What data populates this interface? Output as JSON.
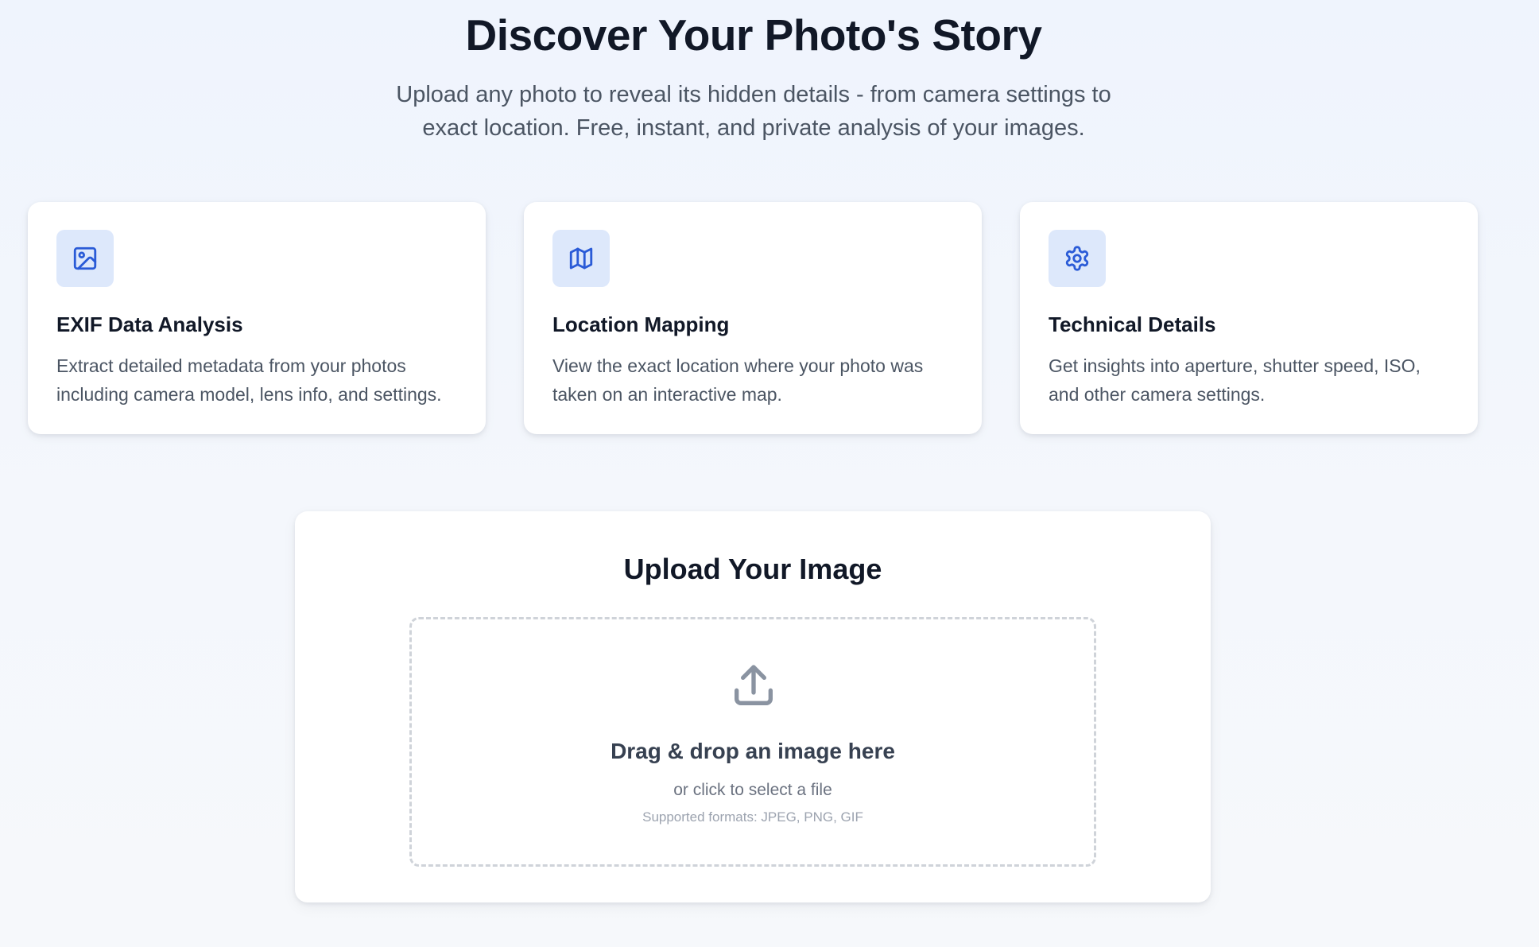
{
  "hero": {
    "title": "Discover Your Photo's Story",
    "subtitle": "Upload any photo to reveal its hidden details - from camera settings to exact location. Free, instant, and private analysis of your images."
  },
  "features": [
    {
      "icon": "image-icon",
      "title": "EXIF Data Analysis",
      "description": "Extract detailed metadata from your photos including camera model, lens info, and settings."
    },
    {
      "icon": "map-icon",
      "title": "Location Mapping",
      "description": "View the exact location where your photo was taken on an interactive map."
    },
    {
      "icon": "gear-icon",
      "title": "Technical Details",
      "description": "Get insights into aperture, shutter speed, ISO, and other camera settings."
    }
  ],
  "upload": {
    "title": "Upload Your Image",
    "icon": "upload-icon",
    "dropzone_text": "Drag & drop an image here",
    "dropzone_subtext": "or click to select a file",
    "formats_text": "Supported formats: JPEG, PNG, GIF"
  },
  "colors": {
    "accent": "#2a5bd7",
    "icon_bg": "#dde8fb",
    "upload_icon": "#8a93a1"
  }
}
